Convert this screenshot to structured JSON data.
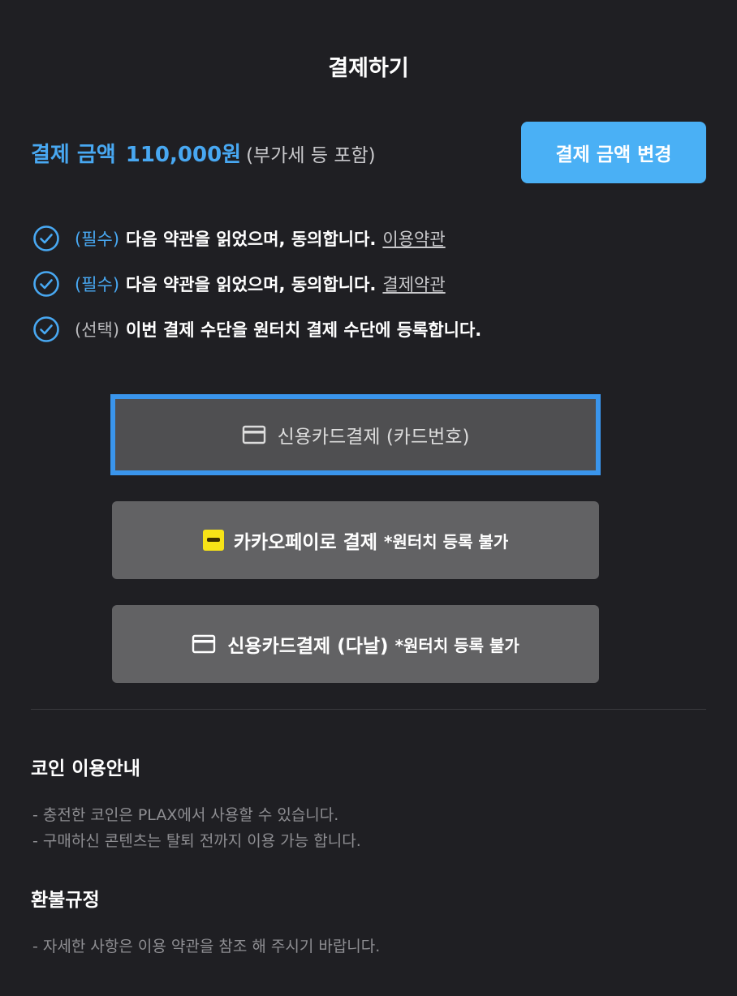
{
  "header": {
    "title": "결제하기"
  },
  "amount": {
    "label": "결제 금액",
    "value": "110,000원",
    "note": "(부가세 등 포함)",
    "change_button": "결제 금액 변경"
  },
  "terms": [
    {
      "tag": "(필수)",
      "text": "다음 약관을 읽었으며, 동의합니다.",
      "link": "이용약관",
      "checked": true
    },
    {
      "tag": "(필수)",
      "text": "다음 약관을 읽었으며, 동의합니다.",
      "link": "결제약관",
      "checked": true
    },
    {
      "tag": "(선택)",
      "text": "이번 결제 수단을 원터치 결제 수단에 등록합니다.",
      "link": "",
      "checked": true
    }
  ],
  "payment_methods": {
    "card_number": {
      "icon": "credit-card-icon",
      "label": "신용카드결제 (카드번호)",
      "selected": true
    },
    "kakaopay": {
      "icon": "kakaopay-icon",
      "label": "카카오페이로 결제",
      "note": "*원터치 등록 불가"
    },
    "danal": {
      "icon": "credit-card-icon",
      "label": "신용카드결제 (다날)",
      "note": "*원터치 등록 불가"
    }
  },
  "coin_info": {
    "title": "코인 이용안내",
    "lines": [
      "- 충전한 코인은 PLAX에서 사용할 수 있습니다.",
      "- 구매하신 콘텐츠는 탈퇴 전까지 이용 가능 합니다."
    ]
  },
  "refund": {
    "title": "환불규정",
    "lines": [
      "- 자세한 사항은 이용 약관을 참조 해 주시기 바랍니다."
    ]
  },
  "colors": {
    "accent": "#48a8f2",
    "button_blue": "#4ab0f5",
    "selected_border": "#3a95ec",
    "background": "#1f1f23"
  }
}
